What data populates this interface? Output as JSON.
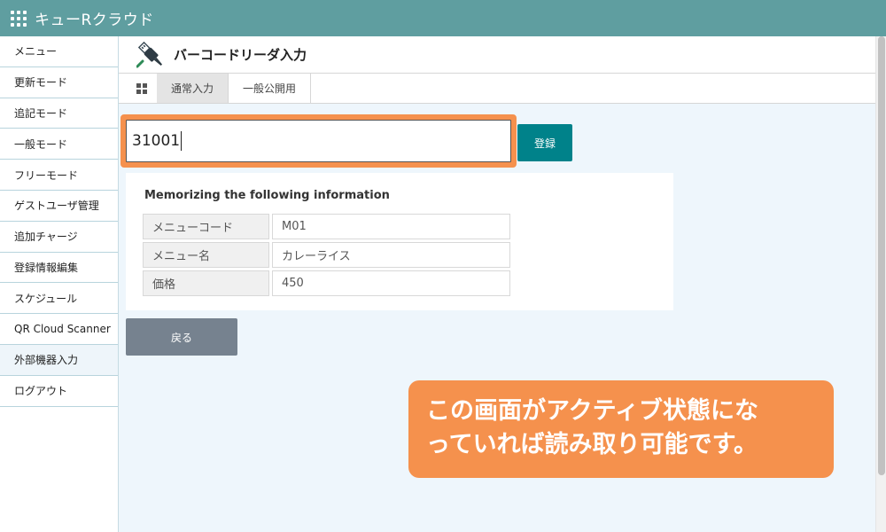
{
  "app": {
    "title": "キューRクラウド"
  },
  "sidebar": {
    "items": [
      {
        "label": "メニュー"
      },
      {
        "label": "更新モード"
      },
      {
        "label": "追記モード"
      },
      {
        "label": "一般モード"
      },
      {
        "label": "フリーモード"
      },
      {
        "label": "ゲストユーザ管理"
      },
      {
        "label": "追加チャージ"
      },
      {
        "label": "登録情報編集"
      },
      {
        "label": "スケジュール"
      },
      {
        "label": "QR Cloud Scanner"
      },
      {
        "label": "外部機器入力"
      },
      {
        "label": "ログアウト"
      }
    ]
  },
  "page": {
    "title": "バーコードリーダ入力"
  },
  "tabs": [
    {
      "label": "通常入力"
    },
    {
      "label": "一般公開用"
    }
  ],
  "form": {
    "barcode_value": "31001",
    "register_label": "登録",
    "back_label": "戻る"
  },
  "info": {
    "heading": "Memorizing the following information",
    "rows": [
      {
        "key": "メニューコード",
        "value": "M01"
      },
      {
        "key": "メニュー名",
        "value": "カレーライス"
      },
      {
        "key": "価格",
        "value": "450"
      }
    ]
  },
  "callout": {
    "line1": "この画面がアクティブ状態にな",
    "line2": "っていれば読み取り可能です。"
  },
  "colors": {
    "topbar": "#5f9ea0",
    "accent_orange": "#f5914d",
    "register_button": "#00828a",
    "back_button": "#76828f"
  },
  "icons": [
    "apps-grid-icon",
    "usb-connector-icon",
    "grid-view-icon"
  ]
}
